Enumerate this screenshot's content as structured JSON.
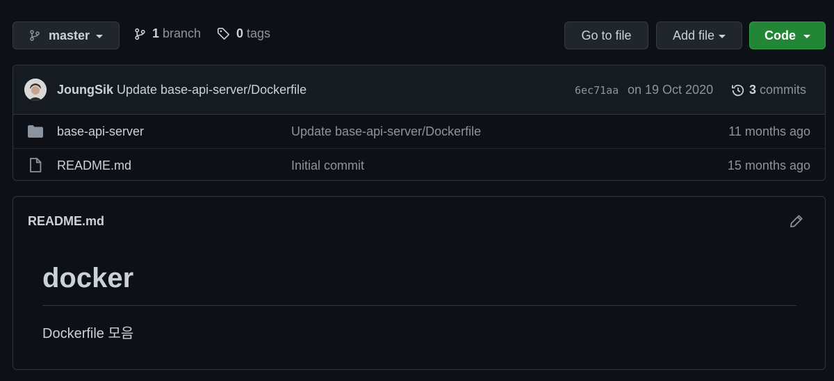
{
  "branch_bar": {
    "branch_selector": "master",
    "branch_count": "1",
    "branch_word": "branch",
    "tag_count": "0",
    "tag_word": "tags"
  },
  "actions": {
    "go_to_file": "Go to file",
    "add_file": "Add file",
    "code": "Code"
  },
  "commit": {
    "author": "JoungSik",
    "message": "Update base-api-server/Dockerfile",
    "hash": "6ec71aa",
    "date": "on 19 Oct 2020",
    "commit_count": "3",
    "commit_word": "commits"
  },
  "files": [
    {
      "icon": "folder-icon",
      "name": "base-api-server",
      "message": "Update base-api-server/Dockerfile",
      "age": "11 months ago"
    },
    {
      "icon": "file-icon",
      "name": "README.md",
      "message": "Initial commit",
      "age": "15 months ago"
    }
  ],
  "readme": {
    "filename": "README.md",
    "heading": "docker",
    "body": "Dockerfile 모음"
  },
  "colors": {
    "background": "#0d1117",
    "panel": "#161b22",
    "code_button": "#238636",
    "text": "#c9d1d9",
    "muted": "#8b949e",
    "border": "#30363d"
  }
}
